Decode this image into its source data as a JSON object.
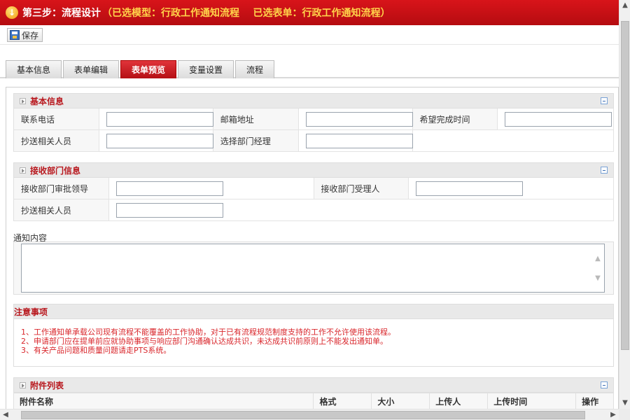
{
  "header": {
    "step_title": "第三步：流程设计",
    "selected_info": "（已选模型：行政工作通知流程    已选表单：行政工作通知流程）",
    "icon": "down-arrow-circle-icon",
    "color": "#c8101a"
  },
  "toolbar": {
    "save_label": "保存",
    "save_icon": "save-disk-icon"
  },
  "tabs": [
    {
      "label": "基本信息",
      "active": false
    },
    {
      "label": "表单编辑",
      "active": false
    },
    {
      "label": "表单预览",
      "active": true
    },
    {
      "label": "变量设置",
      "active": false
    },
    {
      "label": "流程",
      "active": false
    }
  ],
  "basic_info": {
    "title": "基本信息",
    "contact_phone": "联系电话",
    "email": "邮箱地址",
    "expected_time": "希望完成时间",
    "cc_people": "抄送相关人员",
    "dept_manager": "选择部门经理"
  },
  "recv_dept": {
    "title": "接收部门信息",
    "approver": "接收部门审批领导",
    "handler": "接收部门受理人",
    "cc_people": "抄送相关人员"
  },
  "notice_content": {
    "label": "通知内容"
  },
  "notes": {
    "title": "注意事项",
    "lines": [
      "1、工作通知单承载公司现有流程不能覆盖的工作协助，对于已有流程规范制度支持的工作不允许使用该流程。",
      "2、申请部门应在提单前应就协助事项与响应部门沟通确认达成共识，未达成共识前原则上不能发出通知单。",
      "3、有关产品问题和质量问题请走PTS系统。"
    ],
    "color": "#d9262b"
  },
  "attachments": {
    "title": "附件列表",
    "columns": [
      "附件名称",
      "格式",
      "大小",
      "上传人",
      "上传时间",
      "操作"
    ]
  }
}
